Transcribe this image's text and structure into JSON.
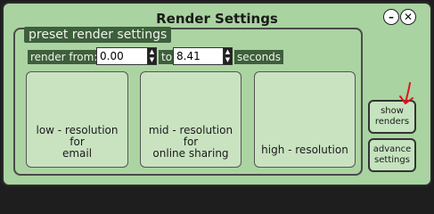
{
  "window": {
    "title": "Render Settings"
  },
  "window_controls": {
    "minimize": "–",
    "close": "✕"
  },
  "preset": {
    "title": "preset render settings",
    "render_from_label": "render from:",
    "from_value": "0.00",
    "to_label": "to:",
    "to_value": "8.41",
    "seconds_label": "seconds"
  },
  "cards": [
    {
      "line1": "low - resolution",
      "line2": "for",
      "line3": "email"
    },
    {
      "line1": "mid - resolution",
      "line2": "for",
      "line3": "online sharing"
    },
    {
      "line1": "high - resolution"
    }
  ],
  "side_buttons": {
    "show_renders": {
      "line1": "show",
      "line2": "renders"
    },
    "advance_settings": {
      "line1": "advance",
      "line2": "settings"
    }
  },
  "annotation_color": "#e0141c"
}
